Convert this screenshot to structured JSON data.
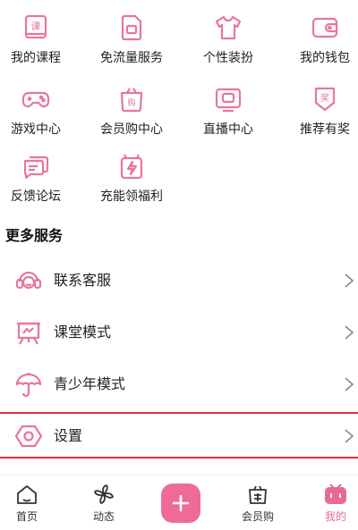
{
  "colors": {
    "accent": "#e86a94",
    "icon_stroke": "#e8769b",
    "highlight": "#d9323f",
    "text": "#222222"
  },
  "grid": [
    [
      {
        "label": "我的课程",
        "icon": "course-book-icon"
      },
      {
        "label": "免流量服务",
        "icon": "sim-card-icon"
      },
      {
        "label": "个性装扮",
        "icon": "tshirt-icon"
      },
      {
        "label": "我的钱包",
        "icon": "wallet-icon"
      }
    ],
    [
      {
        "label": "游戏中心",
        "icon": "gamepad-icon"
      },
      {
        "label": "会员购中心",
        "icon": "shopping-bag-icon"
      },
      {
        "label": "直播中心",
        "icon": "live-tv-icon"
      },
      {
        "label": "推荐有奖",
        "icon": "reward-badge-icon"
      }
    ],
    [
      {
        "label": "反馈论坛",
        "icon": "feedback-chat-icon"
      },
      {
        "label": "充能领福利",
        "icon": "energy-gift-icon"
      }
    ]
  ],
  "grid_icon_text": {
    "course": "课",
    "shop": "购",
    "reward": "奖"
  },
  "more_services": {
    "title": "更多服务",
    "items": [
      {
        "label": "联系客服",
        "icon": "headset-icon"
      },
      {
        "label": "课堂模式",
        "icon": "classroom-easel-icon"
      },
      {
        "label": "青少年模式",
        "icon": "umbrella-icon"
      },
      {
        "label": "设置",
        "icon": "settings-hexagon-icon"
      }
    ]
  },
  "bottom_nav": {
    "items": [
      {
        "label": "首页",
        "icon": "home-icon",
        "active": false
      },
      {
        "label": "动态",
        "icon": "pinwheel-icon",
        "active": false
      },
      {
        "label": "会员购",
        "icon": "shopping-bag-icon",
        "active": false
      },
      {
        "label": "我的",
        "icon": "tv-mascot-icon",
        "active": true
      }
    ],
    "plus_icon": "plus-icon"
  }
}
